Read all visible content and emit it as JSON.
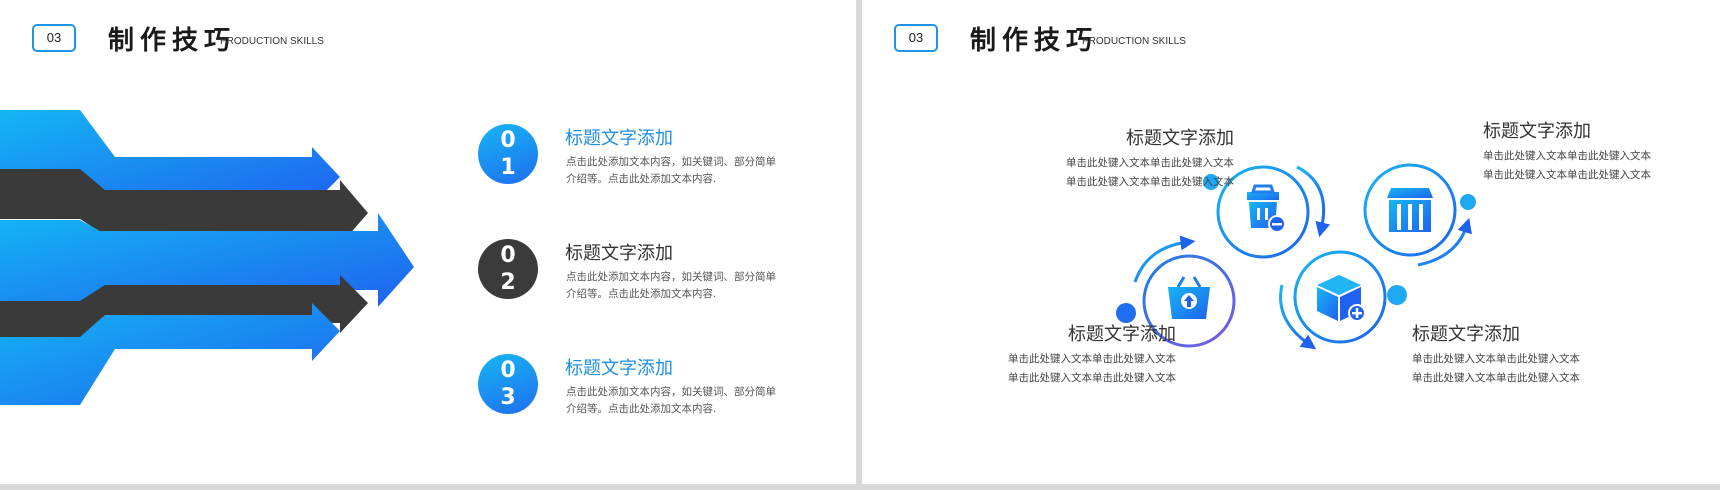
{
  "colors": {
    "accent_blue": "#1f93e6",
    "dark": "#3b3b3b",
    "gradient_start": "#16b6f3",
    "gradient_end": "#1f6ef0"
  },
  "left_slide": {
    "header": {
      "number": "03",
      "title": "制作技巧",
      "subtitle": "PRODUCTION SKILLS"
    },
    "items": [
      {
        "num_top": "0",
        "num_bottom": "1",
        "title": "标题文字添加",
        "text_line1": "点击此处添加文本内容，如关键词、部分简单",
        "text_line2": "介绍等。点击此处添加文本内容.",
        "style": "blue"
      },
      {
        "num_top": "0",
        "num_bottom": "2",
        "title": "标题文字添加",
        "text_line1": "点击此处添加文本内容，如关键词、部分简单",
        "text_line2": "介绍等。点击此处添加文本内容.",
        "style": "dark"
      },
      {
        "num_top": "0",
        "num_bottom": "3",
        "title": "标题文字添加",
        "text_line1": "点击此处添加文本内容，如关键词、部分简单",
        "text_line2": "介绍等。点击此处添加文本内容.",
        "style": "blue"
      }
    ]
  },
  "right_slide": {
    "header": {
      "number": "03",
      "title": "制作技巧",
      "subtitle": "PRODUCTION SKILLS"
    },
    "blocks": [
      {
        "title": "标题文字添加",
        "line1": "单击此处键入文本单击此处键入文本",
        "line2": "单击此处键入文本单击此处键入文本",
        "icon": "shopping-basket-remove-icon"
      },
      {
        "title": "标题文字添加",
        "line1": "单击此处键入文本单击此处键入文本",
        "line2": "单击此处键入文本单击此处键入文本",
        "icon": "store-front-icon"
      },
      {
        "title": "标题文字添加",
        "line1": "单击此处键入文本单击此处键入文本",
        "line2": "单击此处键入文本单击此处键入文本",
        "icon": "basket-upload-icon"
      },
      {
        "title": "标题文字添加",
        "line1": "单击此处键入文本单击此处键入文本",
        "line2": "单击此处键入文本单击此处键入文本",
        "icon": "box-add-icon"
      }
    ]
  }
}
